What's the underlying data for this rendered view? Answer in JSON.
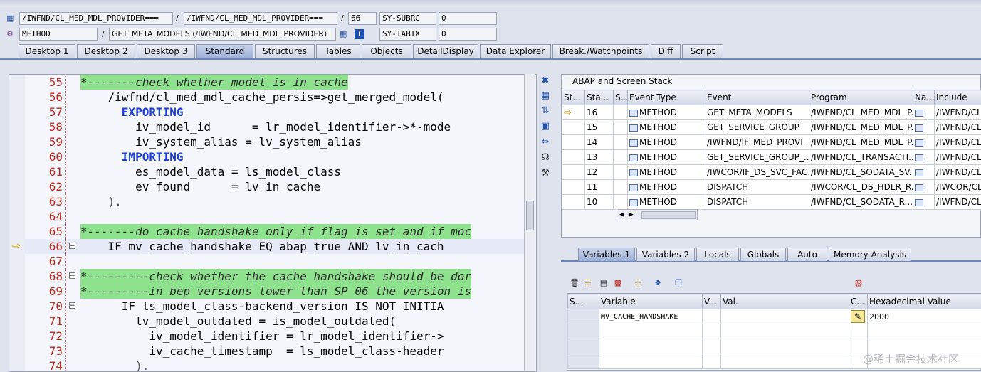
{
  "header": {
    "row1": {
      "field1": "/IWFND/CL_MED_MDL_PROVIDER===",
      "sep1": "/",
      "field2": "/IWFND/CL_MED_MDL_PROVIDER===",
      "sep2": "/",
      "field3": "66",
      "sysname": "SY-SUBRC",
      "sysvalue": "0"
    },
    "row2": {
      "field1": "METHOD",
      "sep1": "/",
      "field2": "GET_META_MODELS (/IWFND/CL_MED_MDL_PROVIDER)",
      "sysname": "SY-TABIX",
      "sysvalue": "0"
    }
  },
  "tabs": [
    "Desktop 1",
    "Desktop 2",
    "Desktop 3",
    "Standard",
    "Structures",
    "Tables",
    "Objects",
    "DetailDisplay",
    "Data Explorer",
    "Break./Watchpoints",
    "Diff",
    "Script"
  ],
  "active_tab": "Standard",
  "code_lines": [
    {
      "num": "55",
      "text": "*-------check whether model is in cache",
      "type": "comment"
    },
    {
      "num": "56",
      "text": "    /iwfnd/cl_med_mdl_cache_persis=>get_merged_model(",
      "type": "code"
    },
    {
      "num": "57",
      "text": "      EXPORTING",
      "type": "kw"
    },
    {
      "num": "58",
      "text": "        iv_model_id      = lr_model_identifier->*-mode",
      "type": "code"
    },
    {
      "num": "59",
      "text": "        iv_system_alias = lv_system_alias",
      "type": "code"
    },
    {
      "num": "60",
      "text": "      IMPORTING",
      "type": "kw"
    },
    {
      "num": "61",
      "text": "        es_model_data = ls_model_class",
      "type": "code"
    },
    {
      "num": "62",
      "text": "        ev_found      = lv_in_cache",
      "type": "code"
    },
    {
      "num": "63",
      "text": "    ).",
      "type": "op"
    },
    {
      "num": "64",
      "text": "",
      "type": "code"
    },
    {
      "num": "65",
      "text": "*-------do cache handshake only if flag is set and if moc",
      "type": "comment"
    },
    {
      "num": "66",
      "text": "    IF mv_cache_handshake EQ abap_true AND lv_in_cach",
      "type": "current"
    },
    {
      "num": "67",
      "text": "",
      "type": "code"
    },
    {
      "num": "68",
      "text": "*---------check whether the cache handshake should be dor",
      "type": "comment"
    },
    {
      "num": "69",
      "text": "*---------in bep versions lower than SP 06 the version is",
      "type": "comment"
    },
    {
      "num": "70",
      "text": "      IF ls_model_class-backend_version IS NOT INITIA",
      "type": "if2"
    },
    {
      "num": "71",
      "text": "        lv_model_outdated = is_model_outdated(",
      "type": "code"
    },
    {
      "num": "72",
      "text": "          iv_model_identifier = lr_model_identifier->",
      "type": "code"
    },
    {
      "num": "73",
      "text": "          iv_cache_timestamp  = ls_model_class-header",
      "type": "code"
    },
    {
      "num": "74",
      "text": "        ).",
      "type": "op"
    }
  ],
  "stack": {
    "title": "ABAP and Screen Stack",
    "columns": [
      "St...",
      "Sta...",
      "S...",
      "Event Type",
      "Event",
      "Program",
      "Na...",
      "Include"
    ],
    "rows": [
      {
        "level": "16",
        "type": "METHOD",
        "event": "GET_META_MODELS",
        "program": "/IWFND/CL_MED_MDL_P...",
        "include": "/IWFND/CL"
      },
      {
        "level": "15",
        "type": "METHOD",
        "event": "GET_SERVICE_GROUP",
        "program": "/IWFND/CL_MED_MDL_P...",
        "include": "/IWFND/CL"
      },
      {
        "level": "14",
        "type": "METHOD",
        "event": "/IWFND/IF_MED_PROVI...",
        "program": "/IWFND/CL_MED_MDL_P...",
        "include": "/IWFND/CL"
      },
      {
        "level": "13",
        "type": "METHOD",
        "event": "GET_SERVICE_GROUP_...",
        "program": "/IWFND/CL_TRANSACTI...",
        "include": "/IWFND/CL"
      },
      {
        "level": "12",
        "type": "METHOD",
        "event": "/IWCOR/IF_DS_SVC_FAC...",
        "program": "/IWFND/CL_SODATA_SV...",
        "include": "/IWFND/CL"
      },
      {
        "level": "11",
        "type": "METHOD",
        "event": "DISPATCH",
        "program": "/IWCOR/CL_DS_HDLR_R...",
        "include": "/IWCOR/CL"
      },
      {
        "level": "10",
        "type": "METHOD",
        "event": "DISPATCH",
        "program": "/IWFND/CL_SODATA_R...",
        "include": "/IWFND/CL"
      }
    ]
  },
  "var_tabs": [
    "Variables 1",
    "Variables 2",
    "Locals",
    "Globals",
    "Auto",
    "Memory Analysis"
  ],
  "active_var_tab": "Variables 1",
  "variables": {
    "columns": [
      "S...",
      "Variable",
      "V...",
      "Val.",
      "C...",
      "Hexadecimal Value"
    ],
    "rows": [
      {
        "name": "MV_CACHE_HANDSHAKE",
        "hex": "2000"
      }
    ]
  },
  "watermark": "@稀土掘金技术社区"
}
